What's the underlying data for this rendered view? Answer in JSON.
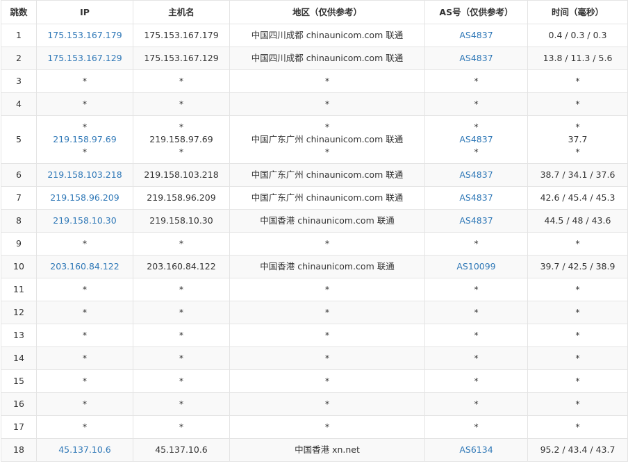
{
  "colors": {
    "link": "#2f78b7",
    "border": "#e4e4e4",
    "stripe": "#f9f9f9",
    "text": "#333333"
  },
  "headers": [
    "跳数",
    "IP",
    "主机名",
    "地区（仅供参考）",
    "AS号（仅供参考）",
    "时间（毫秒）"
  ],
  "rows": [
    {
      "hop": "1",
      "ip": [
        "175.153.167.179"
      ],
      "host": [
        "175.153.167.179"
      ],
      "region": [
        "中国四川成都 chinaunicom.com 联通"
      ],
      "as": [
        "AS4837"
      ],
      "time": [
        "0.4 / 0.3 / 0.3"
      ]
    },
    {
      "hop": "2",
      "ip": [
        "175.153.167.129"
      ],
      "host": [
        "175.153.167.129"
      ],
      "region": [
        "中国四川成都 chinaunicom.com 联通"
      ],
      "as": [
        "AS4837"
      ],
      "time": [
        "13.8 / 11.3 / 5.6"
      ]
    },
    {
      "hop": "3",
      "ip": [
        "*"
      ],
      "host": [
        "*"
      ],
      "region": [
        "*"
      ],
      "as": [
        "*"
      ],
      "time": [
        "*"
      ]
    },
    {
      "hop": "4",
      "ip": [
        "*"
      ],
      "host": [
        "*"
      ],
      "region": [
        "*"
      ],
      "as": [
        "*"
      ],
      "time": [
        "*"
      ]
    },
    {
      "hop": "5",
      "ip": [
        "*",
        "219.158.97.69",
        "*"
      ],
      "host": [
        "*",
        "219.158.97.69",
        "*"
      ],
      "region": [
        "*",
        "中国广东广州 chinaunicom.com 联通",
        "*"
      ],
      "as": [
        "*",
        "AS4837",
        "*"
      ],
      "time": [
        "*",
        "37.7",
        "*"
      ]
    },
    {
      "hop": "6",
      "ip": [
        "219.158.103.218"
      ],
      "host": [
        "219.158.103.218"
      ],
      "region": [
        "中国广东广州 chinaunicom.com 联通"
      ],
      "as": [
        "AS4837"
      ],
      "time": [
        "38.7 / 34.1 / 37.6"
      ]
    },
    {
      "hop": "7",
      "ip": [
        "219.158.96.209"
      ],
      "host": [
        "219.158.96.209"
      ],
      "region": [
        "中国广东广州 chinaunicom.com 联通"
      ],
      "as": [
        "AS4837"
      ],
      "time": [
        "42.6 / 45.4 / 45.3"
      ]
    },
    {
      "hop": "8",
      "ip": [
        "219.158.10.30"
      ],
      "host": [
        "219.158.10.30"
      ],
      "region": [
        "中国香港 chinaunicom.com 联通"
      ],
      "as": [
        "AS4837"
      ],
      "time": [
        "44.5 / 48 / 43.6"
      ]
    },
    {
      "hop": "9",
      "ip": [
        "*"
      ],
      "host": [
        "*"
      ],
      "region": [
        "*"
      ],
      "as": [
        "*"
      ],
      "time": [
        "*"
      ]
    },
    {
      "hop": "10",
      "ip": [
        "203.160.84.122"
      ],
      "host": [
        "203.160.84.122"
      ],
      "region": [
        "中国香港 chinaunicom.com 联通"
      ],
      "as": [
        "AS10099"
      ],
      "time": [
        "39.7 / 42.5 / 38.9"
      ]
    },
    {
      "hop": "11",
      "ip": [
        "*"
      ],
      "host": [
        "*"
      ],
      "region": [
        "*"
      ],
      "as": [
        "*"
      ],
      "time": [
        "*"
      ]
    },
    {
      "hop": "12",
      "ip": [
        "*"
      ],
      "host": [
        "*"
      ],
      "region": [
        "*"
      ],
      "as": [
        "*"
      ],
      "time": [
        "*"
      ]
    },
    {
      "hop": "13",
      "ip": [
        "*"
      ],
      "host": [
        "*"
      ],
      "region": [
        "*"
      ],
      "as": [
        "*"
      ],
      "time": [
        "*"
      ]
    },
    {
      "hop": "14",
      "ip": [
        "*"
      ],
      "host": [
        "*"
      ],
      "region": [
        "*"
      ],
      "as": [
        "*"
      ],
      "time": [
        "*"
      ]
    },
    {
      "hop": "15",
      "ip": [
        "*"
      ],
      "host": [
        "*"
      ],
      "region": [
        "*"
      ],
      "as": [
        "*"
      ],
      "time": [
        "*"
      ]
    },
    {
      "hop": "16",
      "ip": [
        "*"
      ],
      "host": [
        "*"
      ],
      "region": [
        "*"
      ],
      "as": [
        "*"
      ],
      "time": [
        "*"
      ]
    },
    {
      "hop": "17",
      "ip": [
        "*"
      ],
      "host": [
        "*"
      ],
      "region": [
        "*"
      ],
      "as": [
        "*"
      ],
      "time": [
        "*"
      ]
    },
    {
      "hop": "18",
      "ip": [
        "45.137.10.6"
      ],
      "host": [
        "45.137.10.6"
      ],
      "region": [
        "中国香港 xn.net"
      ],
      "as": [
        "AS6134"
      ],
      "time": [
        "95.2 / 43.4 / 43.7"
      ]
    }
  ]
}
